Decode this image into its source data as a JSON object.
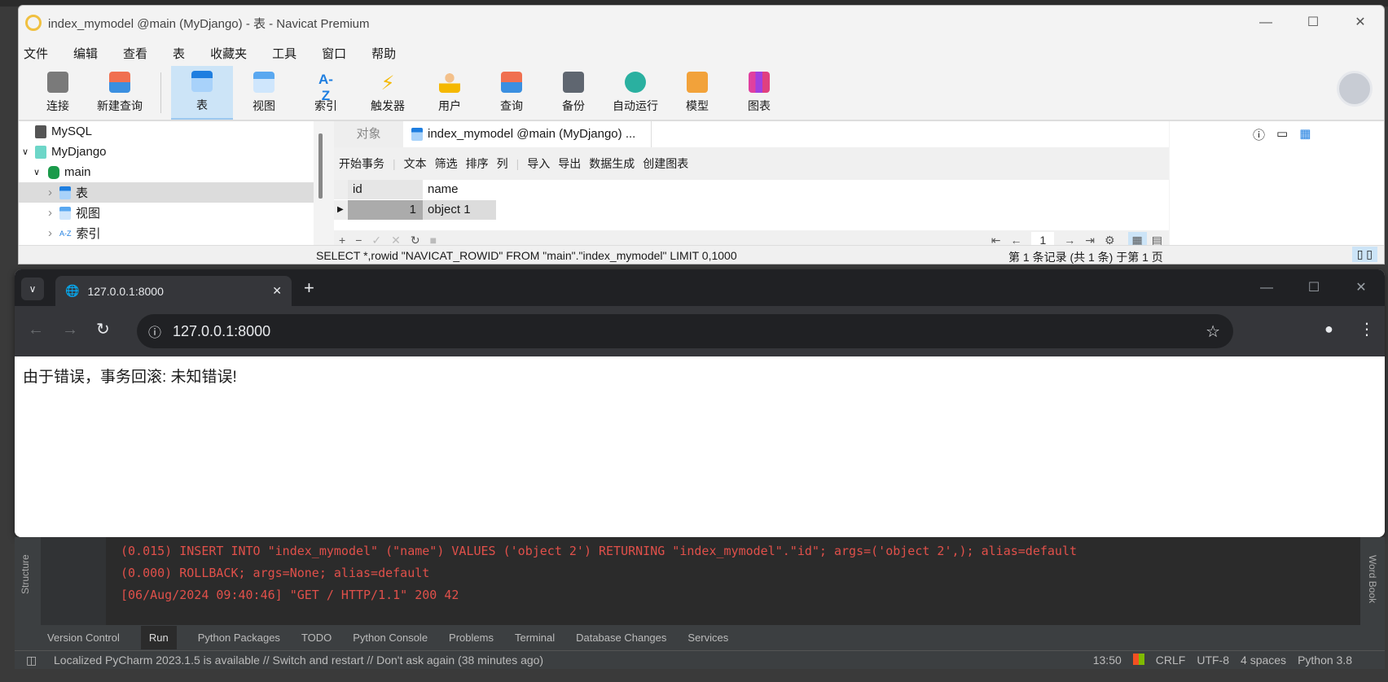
{
  "navicat": {
    "title": "index_mymodel @main (MyDjango) - 表 - Navicat Premium",
    "menu": [
      "文件",
      "编辑",
      "查看",
      "表",
      "收藏夹",
      "工具",
      "窗口",
      "帮助"
    ],
    "toolbar": [
      "连接",
      "新建查询",
      "表",
      "视图",
      "索引",
      "触发器",
      "用户",
      "查询",
      "备份",
      "自动运行",
      "模型",
      "图表"
    ],
    "tree": [
      "MySQL",
      "MyDjango",
      "main",
      "表",
      "视图",
      "索引"
    ],
    "tabs": {
      "objects": "对象",
      "active": "index_mymodel @main (MyDjango) ..."
    },
    "subtoolbar": [
      "开始事务",
      "文本",
      "筛选",
      "排序",
      "列",
      "导入",
      "导出",
      "数据生成",
      "创建图表"
    ],
    "grid": {
      "columns": [
        "id",
        "name"
      ],
      "rows": [
        [
          "1",
          "object 1"
        ]
      ]
    },
    "pager": {
      "page": "1"
    },
    "status": {
      "sql": "SELECT *,rowid \"NAVICAT_ROWID\" FROM \"main\".\"index_mymodel\" LIMIT 0,1000",
      "record": "第 1 条记录  (共 1 条)  于第 1 页"
    }
  },
  "browser": {
    "tab_title": "127.0.0.1:8000",
    "url": "127.0.0.1:8000",
    "page_text": "由于错误，事务回滚: 未知错误!"
  },
  "pycharm": {
    "console": [
      "(0.015) INSERT INTO \"index_mymodel\" (\"name\") VALUES ('object 2') RETURNING \"index_mymodel\".\"id\"; args=('object 2',); alias=default",
      "(0.000) ROLLBACK; args=None; alias=default",
      "[06/Aug/2024 09:40:46] \"GET / HTTP/1.1\" 200 42"
    ],
    "left_tool": "Structure",
    "right_tool": "Word Book",
    "tool_tabs": [
      "Version Control",
      "Run",
      "Python Packages",
      "TODO",
      "Python Console",
      "Problems",
      "Terminal",
      "Database Changes",
      "Services"
    ],
    "status_msg": "Localized PyCharm 2023.1.5 is available // Switch and restart // Don't ask again (38 minutes ago)",
    "status_right": [
      "13:50",
      "CRLF",
      "UTF-8",
      "4 spaces",
      "Python 3.8"
    ]
  }
}
